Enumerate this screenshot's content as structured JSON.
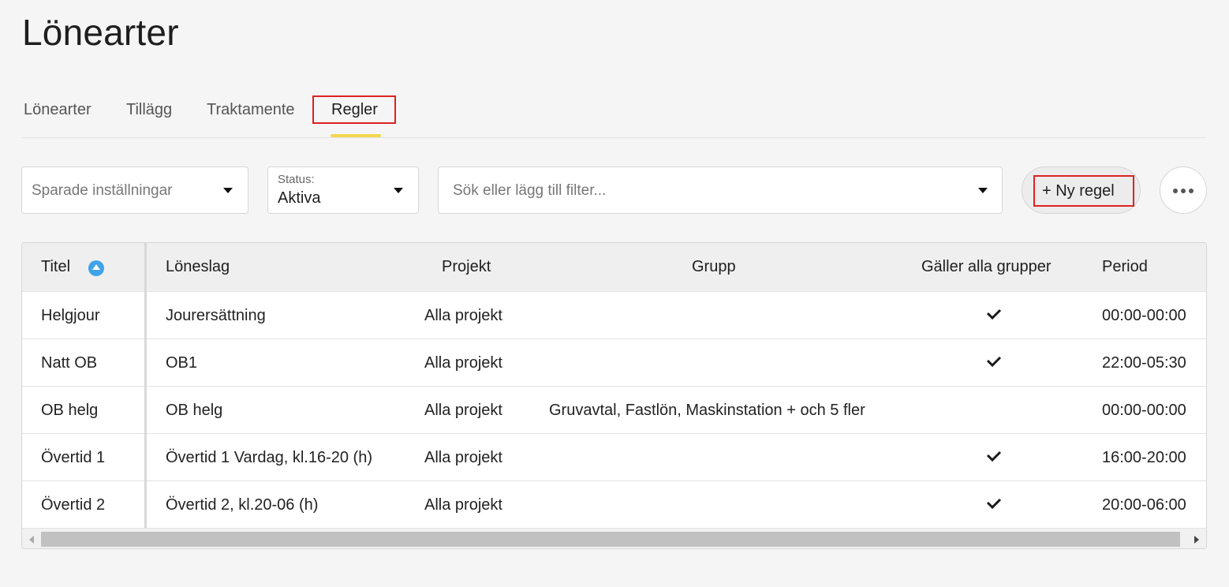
{
  "page": {
    "title": "Lönearter"
  },
  "tabs": [
    {
      "label": "Lönearter",
      "active": false
    },
    {
      "label": "Tillägg",
      "active": false
    },
    {
      "label": "Traktamente",
      "active": false
    },
    {
      "label": "Regler",
      "active": true
    }
  ],
  "toolbar": {
    "saved_settings_placeholder": "Sparade inställningar",
    "status_label": "Status:",
    "status_value": "Aktiva",
    "search_placeholder": "Sök eller lägg till filter...",
    "new_rule_label": "+ Ny regel",
    "more_icon": "ellipsis-icon"
  },
  "table": {
    "columns": [
      "Titel",
      "Löneslag",
      "Projekt",
      "Grupp",
      "Gäller alla grupper",
      "Period"
    ],
    "sort_icon": "sort-ascending-icon",
    "rows": [
      {
        "titel": "Helgjour",
        "loneslag": "Jourersättning",
        "projekt": "Alla projekt",
        "grupp": "",
        "galler_alla": true,
        "period": "00:00-00:00"
      },
      {
        "titel": "Natt OB",
        "loneslag": "OB1",
        "projekt": "Alla projekt",
        "grupp": "",
        "galler_alla": true,
        "period": "22:00-05:30"
      },
      {
        "titel": "OB helg",
        "loneslag": "OB helg",
        "projekt": "Alla projekt",
        "grupp": "Gruvavtal, Fastlön, Maskinstation + och 5 fler",
        "galler_alla": false,
        "period": "00:00-00:00"
      },
      {
        "titel": "Övertid 1",
        "loneslag": "Övertid 1 Vardag, kl.16-20 (h)",
        "projekt": "Alla projekt",
        "grupp": "",
        "galler_alla": true,
        "period": "16:00-20:00"
      },
      {
        "titel": "Övertid 2",
        "loneslag": "Övertid 2, kl.20-06 (h)",
        "projekt": "Alla projekt",
        "grupp": "",
        "galler_alla": true,
        "period": "20:00-06:00"
      }
    ]
  },
  "colors": {
    "accent_underline": "#f5d64e",
    "highlight_box": "#dd2222",
    "sort_icon": "#3fa3e8"
  }
}
